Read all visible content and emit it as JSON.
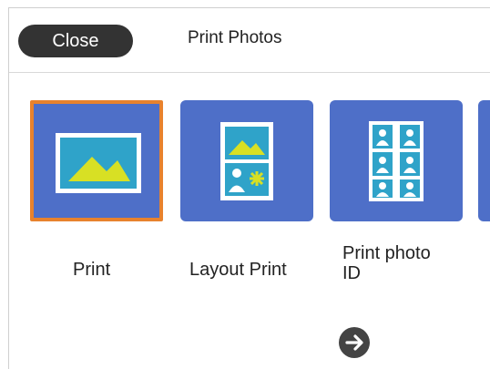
{
  "header": {
    "close_label": "Close",
    "title": "Print Photos"
  },
  "options": [
    {
      "label": "Print",
      "icon": "single-photo-icon",
      "selected": true
    },
    {
      "label": "Layout Print",
      "icon": "layout-print-icon",
      "selected": false
    },
    {
      "label": "Print photo ID",
      "label_line1": "Print photo",
      "label_line2": "ID",
      "icon": "photo-id-icon",
      "selected": false
    }
  ],
  "next": {
    "icon": "arrow-right-icon"
  },
  "colors": {
    "tile": "#4e6fc8",
    "selected_border": "#e8822d",
    "mountain": "#d8e024",
    "photo_bg": "#2fa3c9",
    "close_button": "#333333"
  }
}
